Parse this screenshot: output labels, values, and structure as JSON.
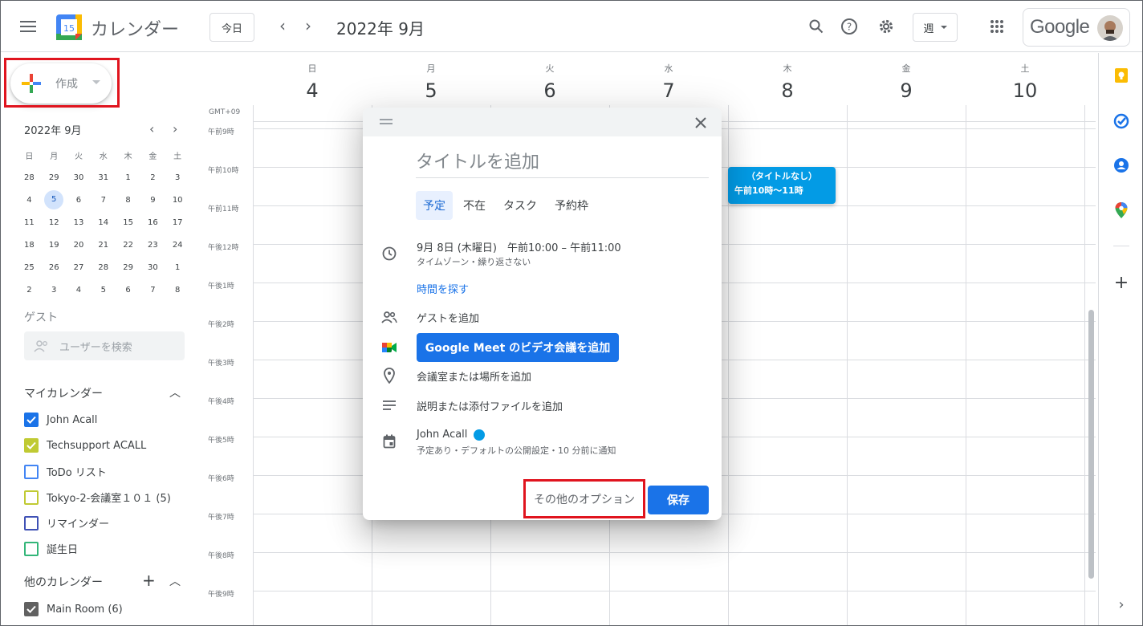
{
  "header": {
    "app_title": "カレンダー",
    "logo_day": "15",
    "today_label": "今日",
    "prev_icon": "chevron-left",
    "next_icon": "chevron-right",
    "month_title": "2022年 9月",
    "view_label": "週",
    "brand": "Google"
  },
  "sidebar": {
    "create_label": "作成",
    "mini_title": "2022年 9月",
    "mini_dow": [
      "日",
      "月",
      "火",
      "水",
      "木",
      "金",
      "土"
    ],
    "mini_weeks": [
      [
        "28",
        "29",
        "30",
        "31",
        "1",
        "2",
        "3"
      ],
      [
        "4",
        "5",
        "6",
        "7",
        "8",
        "9",
        "10"
      ],
      [
        "11",
        "12",
        "13",
        "14",
        "15",
        "16",
        "17"
      ],
      [
        "18",
        "19",
        "20",
        "21",
        "22",
        "23",
        "24"
      ],
      [
        "25",
        "26",
        "27",
        "28",
        "29",
        "30",
        "1"
      ],
      [
        "2",
        "3",
        "4",
        "5",
        "6",
        "7",
        "8"
      ]
    ],
    "mini_today": "5",
    "guest_heading": "ゲスト",
    "guest_placeholder": "ユーザーを検索",
    "my_calendars_heading": "マイカレンダー",
    "my_calendars": [
      {
        "label": "John Acall",
        "color": "#1a73e8",
        "checked": true
      },
      {
        "label": "Techsupport ACALL",
        "color": "#c0ca33",
        "checked": true
      },
      {
        "label": "ToDo リスト",
        "color": "#4285f4",
        "checked": false
      },
      {
        "label": "Tokyo-2-会議室１０１ (5)",
        "color": "#c0ca33",
        "checked": false
      },
      {
        "label": "リマインダー",
        "color": "#3f51b5",
        "checked": false
      },
      {
        "label": "誕生日",
        "color": "#33b679",
        "checked": false
      }
    ],
    "other_calendars_heading": "他のカレンダー",
    "other_calendars": [
      {
        "label": "Main Room (6)",
        "color": "#616161",
        "checked": true
      }
    ]
  },
  "week": {
    "days": [
      {
        "dow": "日",
        "num": "4"
      },
      {
        "dow": "月",
        "num": "5"
      },
      {
        "dow": "火",
        "num": "6"
      },
      {
        "dow": "水",
        "num": "7"
      },
      {
        "dow": "木",
        "num": "8"
      },
      {
        "dow": "金",
        "num": "9"
      },
      {
        "dow": "土",
        "num": "10"
      }
    ],
    "timezone": "GMT+09",
    "hours": [
      "午前9時",
      "午前10時",
      "午前11時",
      "午後12時",
      "午後1時",
      "午後2時",
      "午後3時",
      "午後4時",
      "午後5時",
      "午後6時",
      "午後7時",
      "午後8時",
      "午後9時"
    ],
    "event": {
      "title": "（タイトルなし）",
      "time": "午前10時〜11時",
      "color": "#039be5"
    }
  },
  "dialog": {
    "title_placeholder": "タイトルを追加",
    "tabs": [
      "予定",
      "不在",
      "タスク",
      "予約枠"
    ],
    "active_tab": "予定",
    "datetime": "9月 8日 (木曜日)　午前10:00 – 午前11:00",
    "datetime_sub": "タイムゾーン・繰り返さない",
    "find_time": "時間を探す",
    "add_guests": "ゲストを追加",
    "meet_button": "Google Meet のビデオ会議を追加",
    "add_location": "会議室または場所を追加",
    "add_description": "説明または添付ファイルを追加",
    "calendar_owner": "John Acall",
    "calendar_sub": "予定あり・デフォルトの公開設定・10 分前に通知",
    "more_options": "その他のオプション",
    "save": "保存"
  },
  "colors": {
    "accent": "#1a73e8",
    "highlight_box": "#e0141e"
  }
}
